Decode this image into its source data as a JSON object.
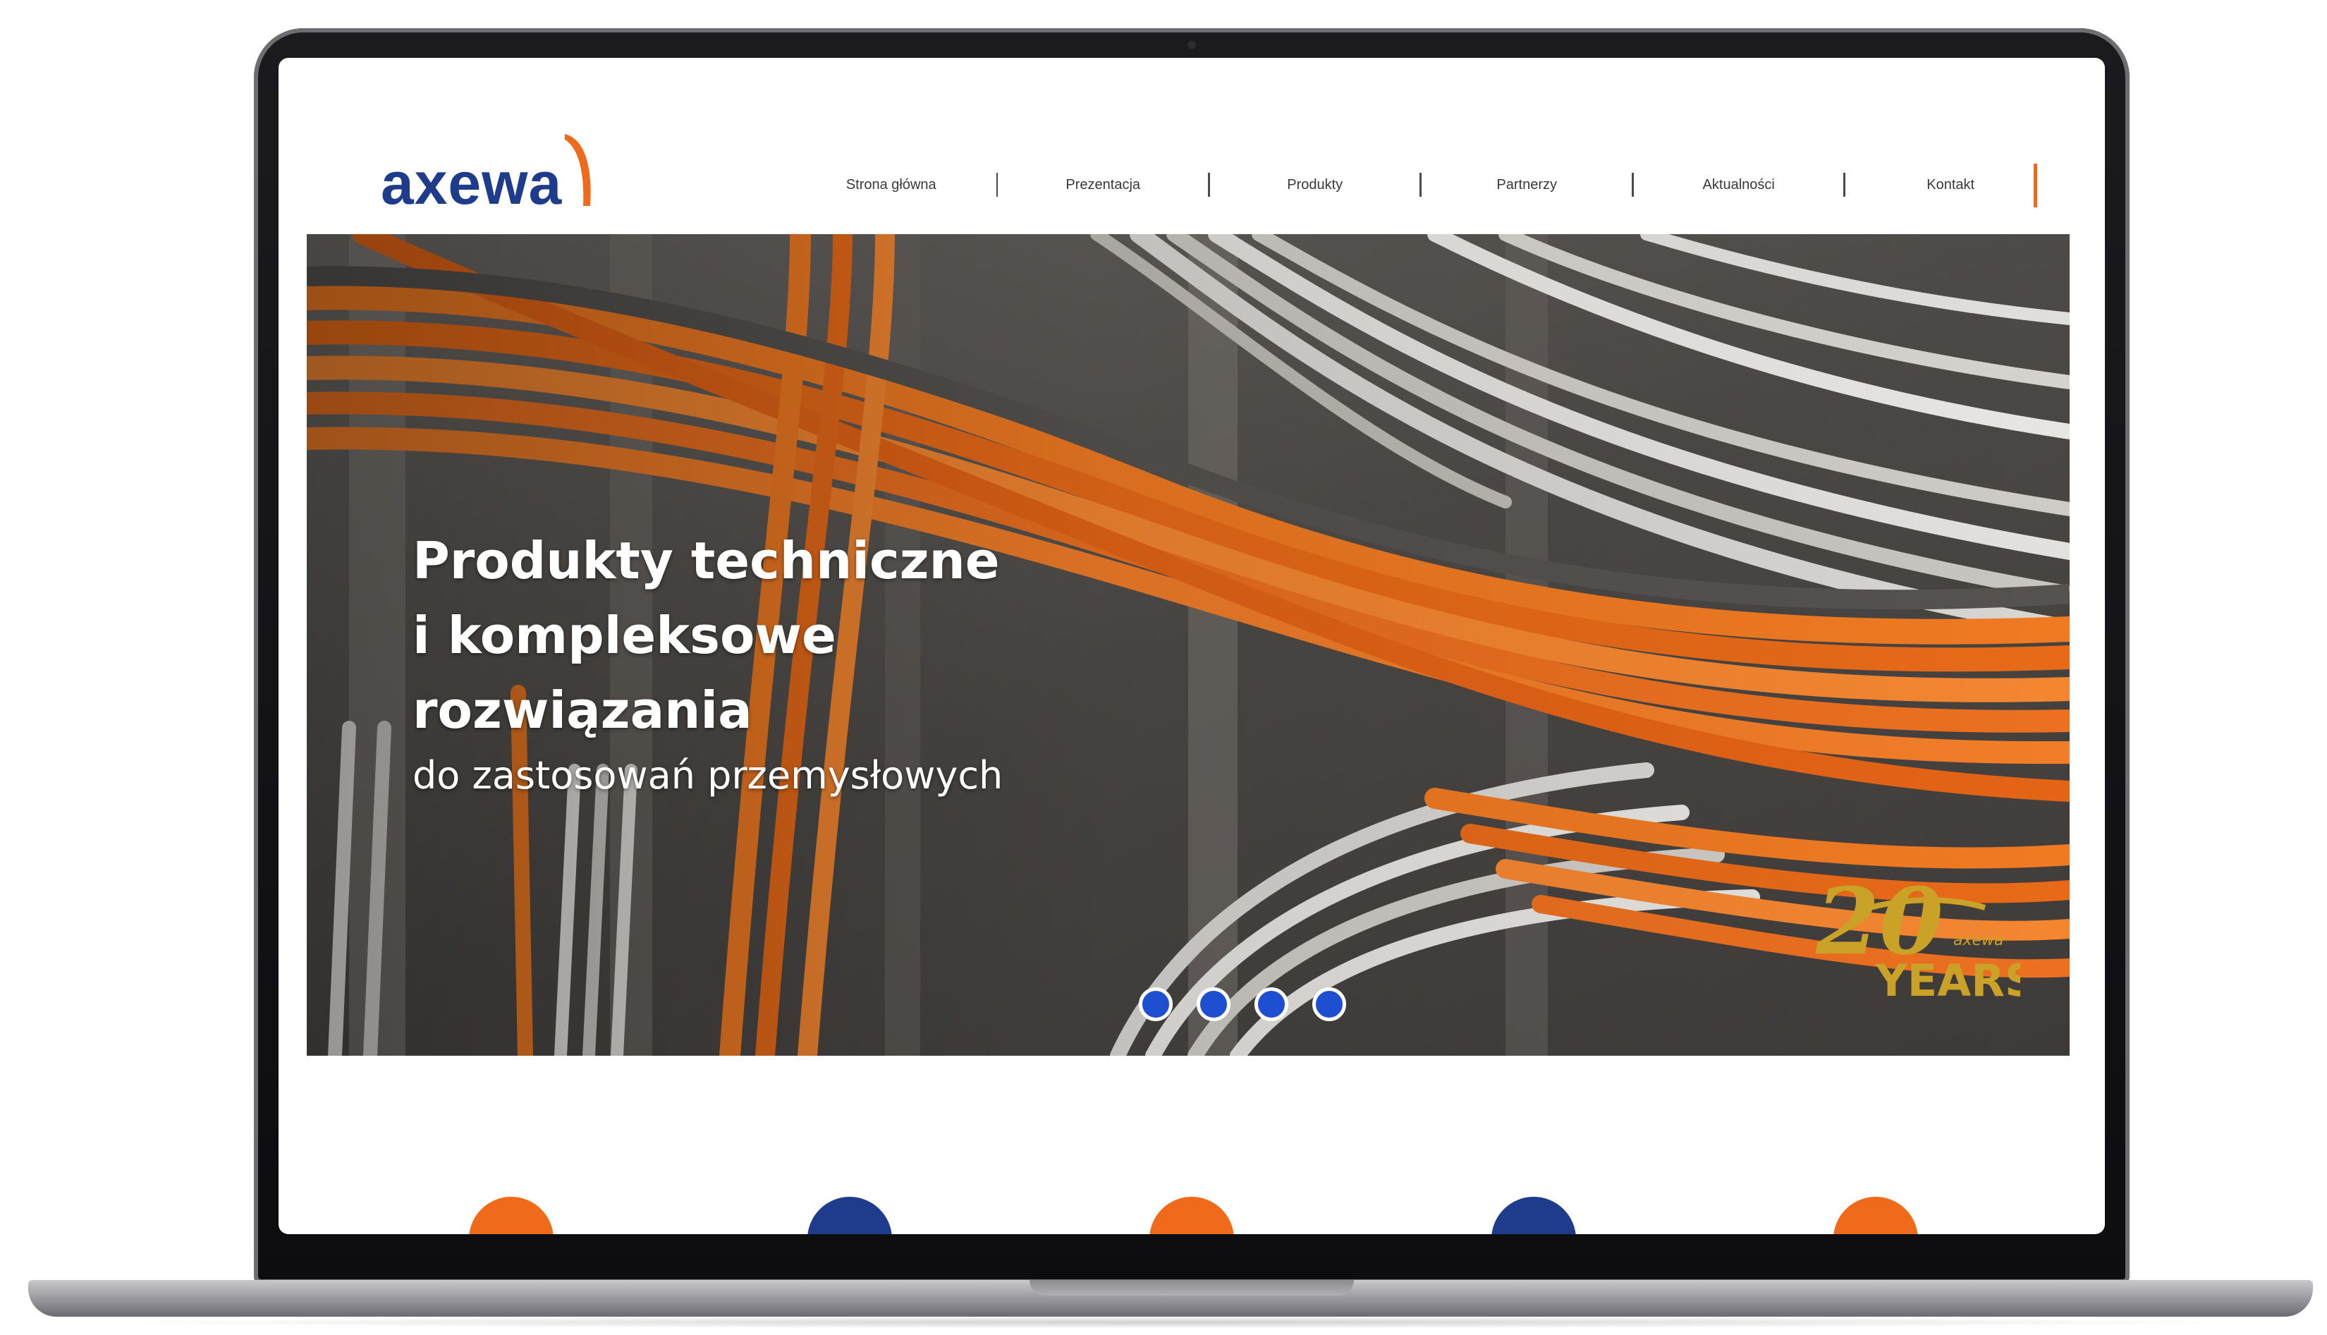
{
  "brand": {
    "name": "axewa",
    "primary_color": "#1f3b8c",
    "accent_color": "#f06a1c"
  },
  "nav": {
    "items": [
      {
        "label": "Strona główna"
      },
      {
        "label": "Prezentacja"
      },
      {
        "label": "Produkty"
      },
      {
        "label": "Partnerzy"
      },
      {
        "label": "Aktualności"
      },
      {
        "label": "Kontakt"
      }
    ]
  },
  "hero": {
    "title_lines": [
      "Produkty techniczne",
      "i kompleksowe",
      "rozwiązania"
    ],
    "subtitle": "do zastosowań przemysłowych",
    "slider": {
      "dot_count": 4,
      "dot_color": "#1f4fd1"
    },
    "badge": {
      "number": "20",
      "label": "YEARS",
      "small_text": "axewa",
      "color": "#c9a227"
    }
  },
  "features": {
    "circle_colors": [
      "#f06a1c",
      "#1f3b8c",
      "#f06a1c",
      "#1f3b8c",
      "#f06a1c"
    ]
  },
  "icons": {
    "logo_swoosh": "logo-swoosh-icon",
    "slider_dot": "slider-dot-icon",
    "anniversary_badge": "anniversary-badge-icon"
  }
}
